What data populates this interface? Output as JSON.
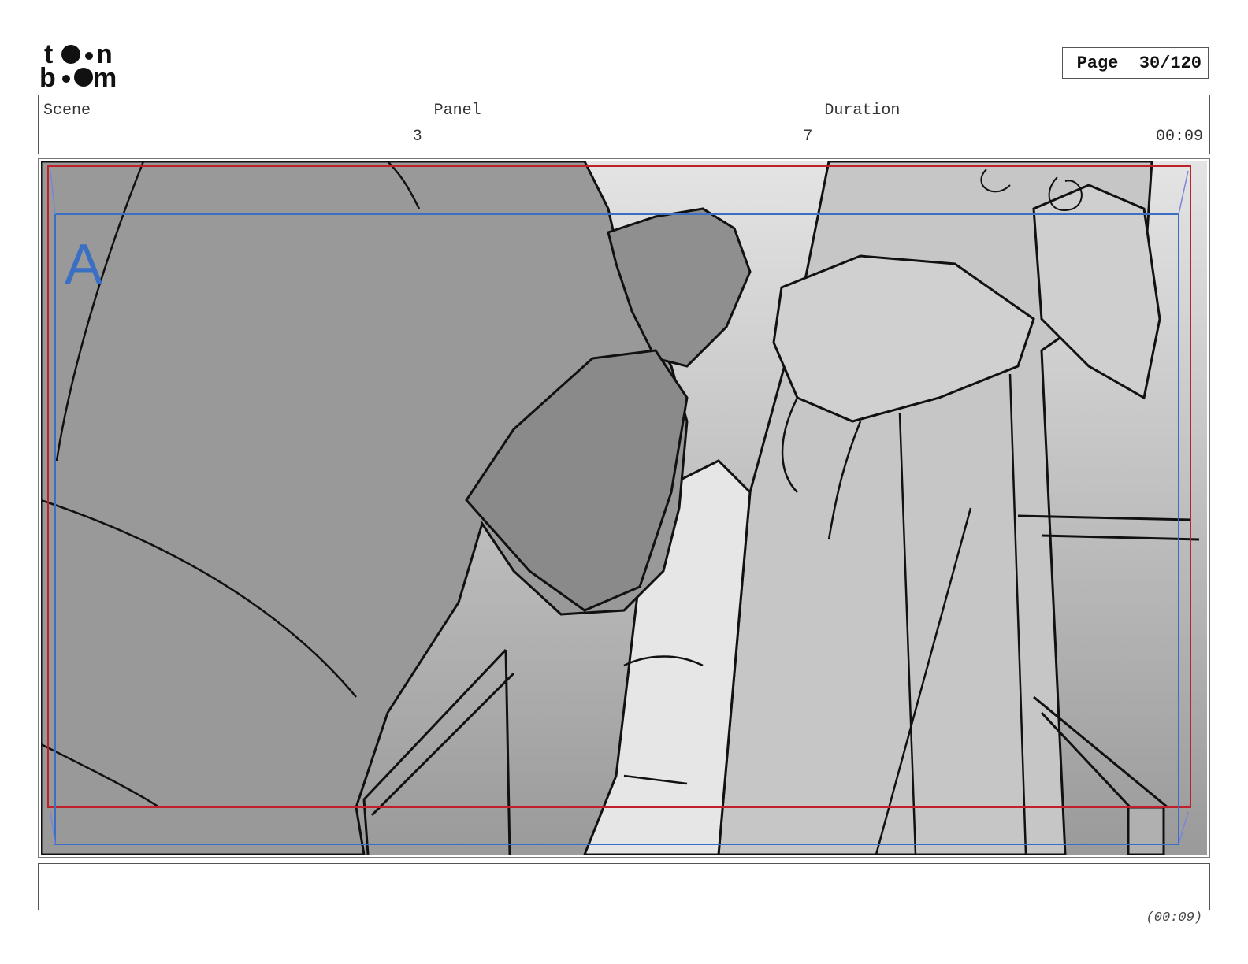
{
  "logo": {
    "line1": "toon",
    "line2": "boom",
    "icon": "toon-boom-logo"
  },
  "header": {
    "page_label": "Page",
    "page_value": "30/120"
  },
  "info": {
    "scene": {
      "label": "Scene",
      "value": "3"
    },
    "panel": {
      "label": "Panel",
      "value": "7"
    },
    "duration": {
      "label": "Duration",
      "value": "00:09"
    }
  },
  "panel": {
    "layer_label": "A",
    "colors": {
      "safe_frame": "#c0202a",
      "camera_frame": "#3a6fc4",
      "layer_label": "#3a6fc4"
    }
  },
  "notes": {
    "text": ""
  },
  "footer": {
    "duration": "(00:09)"
  }
}
